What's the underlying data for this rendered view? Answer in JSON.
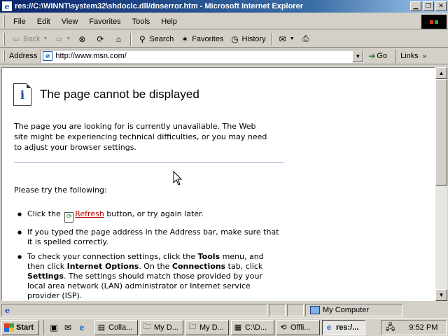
{
  "window": {
    "title": "res://C:\\WINNT\\system32\\shdoclc.dll/dnserror.htm - Microsoft Internet Explorer"
  },
  "menu": [
    "File",
    "Edit",
    "View",
    "Favorites",
    "Tools",
    "Help"
  ],
  "toolbar": {
    "back_label": "Back",
    "search_label": "Search",
    "favorites_label": "Favorites",
    "history_label": "History"
  },
  "address": {
    "label": "Address",
    "url": "http://www.msn.com/",
    "go_label": "Go",
    "links_label": "Links"
  },
  "page": {
    "title": "The page cannot be displayed",
    "intro_lines": [
      "The page you are looking for is currently unavailable. The Web",
      "site might be experiencing technical difficulties, or you may need",
      "to adjust your browser settings."
    ],
    "try_text": "Please try the following:",
    "tips": [
      {
        "pre": "Click the",
        "link": "Refresh",
        "post": "button, or try again later."
      },
      {
        "text": "If you typed the page address in the Address bar, make sure that it is spelled correctly."
      },
      {
        "t1": "To check your connection settings, click the ",
        "b1": "Tools",
        "t2": " menu, and then click ",
        "b2": "Internet Options",
        "t3": ". On the ",
        "b3": "Connections",
        "t4": " tab, click ",
        "b4": "Settings",
        "t5": ". The settings should match those provided by your local area network (LAN) administrator or Internet service provider (ISP)."
      }
    ]
  },
  "status": {
    "zone": "My Computer"
  },
  "taskbar": {
    "start_label": "Start",
    "tasks": [
      "Colla...",
      "My D...",
      "My D...",
      "C:\\D...",
      "Offli...",
      "res:/..."
    ],
    "clock": "9:52 PM"
  }
}
